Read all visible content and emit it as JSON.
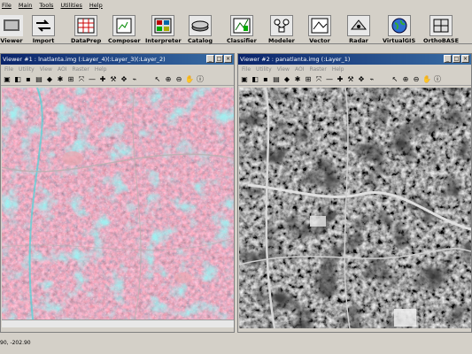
{
  "menubar": {
    "items": [
      "File",
      "Main",
      "Tools",
      "Utilities",
      "Help"
    ]
  },
  "toolbar": {
    "buttons": [
      {
        "label": "Viewer",
        "icon": "viewer-icon"
      },
      {
        "label": "Import",
        "icon": "import-arrows-icon"
      },
      {
        "label": "DataPrep",
        "icon": "dataprep-grid-icon"
      },
      {
        "label": "Composer",
        "icon": "composer-map-icon"
      },
      {
        "label": "Interpreter",
        "icon": "interpreter-grid-icon"
      },
      {
        "label": "Catalog",
        "icon": "catalog-disk-icon"
      },
      {
        "label": "Classifier",
        "icon": "classifier-icon"
      },
      {
        "label": "Modeler",
        "icon": "modeler-flow-icon"
      },
      {
        "label": "Vector",
        "icon": "vector-icon"
      },
      {
        "label": "Radar",
        "icon": "radar-icon"
      },
      {
        "label": "VirtualGIS",
        "icon": "globe-icon"
      },
      {
        "label": "OrthoBASE",
        "icon": "orthobase-icon"
      }
    ]
  },
  "viewer1": {
    "title": "Viewer #1 : lnatlanta.img (:Layer_4)(:Layer_3)(:Layer_2)",
    "menu": [
      "File",
      "Utility",
      "View",
      "AOI",
      "Raster",
      "Help"
    ]
  },
  "viewer2": {
    "title": "Viewer #2 : panatlanta.img (:Layer_1)",
    "menu": [
      "File",
      "Utility",
      "View",
      "AOI",
      "Raster",
      "Help"
    ]
  },
  "status": {
    "coords": "90, -202.90"
  },
  "colors": {
    "title_bar": "#0a246a",
    "desktop": "#d4d0c8",
    "false_color_red": "#8a4a55",
    "cyan": "#4fd6d8"
  }
}
